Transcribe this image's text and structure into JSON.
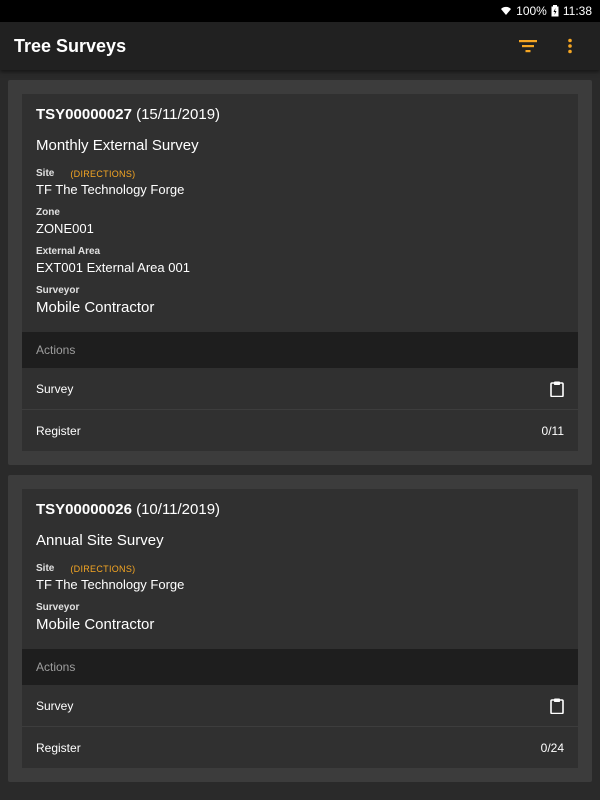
{
  "status": {
    "battery": "100%",
    "time": "11:38"
  },
  "appbar": {
    "title": "Tree Surveys",
    "accent": "#f5a623"
  },
  "surveys": [
    {
      "ref": "TSY00000027",
      "date": "(15/11/2019)",
      "type": "Monthly External Survey",
      "site_label": "Site",
      "directions": "(DIRECTIONS)",
      "site": "TF The Technology Forge",
      "zone_label": "Zone",
      "zone": "ZONE001",
      "area_label": "External Area",
      "area": "EXT001 External Area 001",
      "surveyor_label": "Surveyor",
      "surveyor": "Mobile Contractor",
      "actions_label": "Actions",
      "survey_label": "Survey",
      "register_label": "Register",
      "register_count": "0/11"
    },
    {
      "ref": "TSY00000026",
      "date": "(10/11/2019)",
      "type": "Annual Site Survey",
      "site_label": "Site",
      "directions": "(DIRECTIONS)",
      "site": "TF The Technology Forge",
      "surveyor_label": "Surveyor",
      "surveyor": "Mobile Contractor",
      "actions_label": "Actions",
      "survey_label": "Survey",
      "register_label": "Register",
      "register_count": "0/24"
    }
  ]
}
